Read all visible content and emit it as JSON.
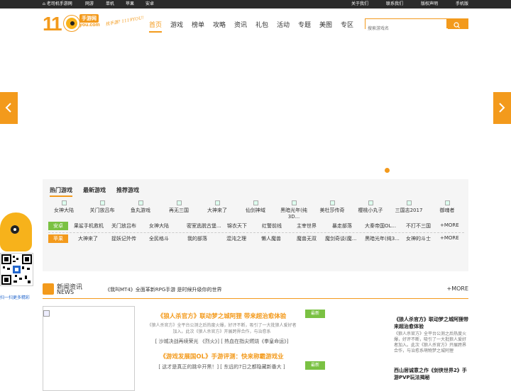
{
  "topbar": {
    "site_link": "老司机手游网",
    "links": [
      "网游",
      "单机",
      "苹果",
      "安卓"
    ],
    "right_links": [
      "关于我们",
      "联系我们",
      "版权声明",
      "手机版"
    ]
  },
  "logo": {
    "text": "11",
    "badge": "手游网",
    "domain": "you.com",
    "slogan": "找手游? 1119YOU!"
  },
  "nav": [
    "首页",
    "游戏",
    "榜单",
    "攻略",
    "资讯",
    "礼包",
    "活动",
    "专题",
    "美图",
    "专区"
  ],
  "search": {
    "placeholder": "搜索游戏名"
  },
  "game_tabs": [
    "热门游戏",
    "最新游戏",
    "推荐游戏"
  ],
  "hot_games": [
    "女神大陆",
    "关门放吕布",
    "鱼丸游戏",
    "再无三国",
    "大神来了",
    "仙剑神域",
    "黑暗光年(纯3D...",
    "美杜莎传奇",
    "樱桃小丸子",
    "三国志2017",
    "御魂者"
  ],
  "android_row": {
    "label": "安卓",
    "games": [
      "果鲨手机救机",
      "关门放吕布",
      "女神大陆",
      "密室逃脱古堡...",
      "锦衣天下",
      "红警前线",
      "主宰世界",
      "暴走部落",
      "大秦帝国OL...",
      "不打不三国"
    ],
    "more": "+MORE"
  },
  "apple_row": {
    "label": "苹果",
    "games": [
      "大神来了",
      "捉妖记外传",
      "全民格斗",
      "我的部落",
      "混沌之理",
      "懒人魔兽",
      "魔兽无双",
      "魔剑奇谈(魔...",
      "黑暗光年(纯3...",
      "女神的斗士"
    ],
    "more": "+MORE"
  },
  "sidebar": {
    "qr_text": "扫一扫更多精彩"
  },
  "news": {
    "title_cn": "新闻资讯",
    "title_en": "NEWS",
    "scroll_text": "《我叫MT4》全面革新RPG手游 是时候升级你的世界",
    "more": "+MORE"
  },
  "center_news": [
    {
      "title": "《狼人杀官方》联动梦之城阿狸 带来超治愈体验",
      "desc": "《狼人杀官方》全平台公测之后热度火爆，好评不断，吸引了一大批狼人爱好者加入。此次《狼人杀官方》开展跨界合作，与治愈系",
      "sub": "[ 沙城决战再续荣光 《烈火》] [ 热血在指尖燃烧《拳皇命运》]"
    },
    {
      "title": "《游戏发展国OL》手游评测：快来称霸游戏业",
      "desc": "",
      "sub": "[ 这才是真正的跳伞开黑！] [ 东远的7日之都隐藏新番大 ]"
    }
  ],
  "right_news": [
    {
      "tag": "最新",
      "title": "《狼人杀官方》联动梦之城阿狸带来超治愈体验",
      "desc": "《狼人杀官方》全平台公测之后热度火爆，好评不断，吸引了一大批狼人爱好者加入。此次《狼人杀官方》开展跨界合作，与治愈系萌物梦之城阿狸"
    },
    {
      "tag": "最新",
      "title": "西山居诚意之作《剑侠世界2》手游PVP玩法揭秘",
      "desc": ""
    }
  ],
  "colors": {
    "accent": "#f39a1c",
    "topbar": "#2b2b2b",
    "android": "#7ac143",
    "apple": "#f39a1c"
  }
}
